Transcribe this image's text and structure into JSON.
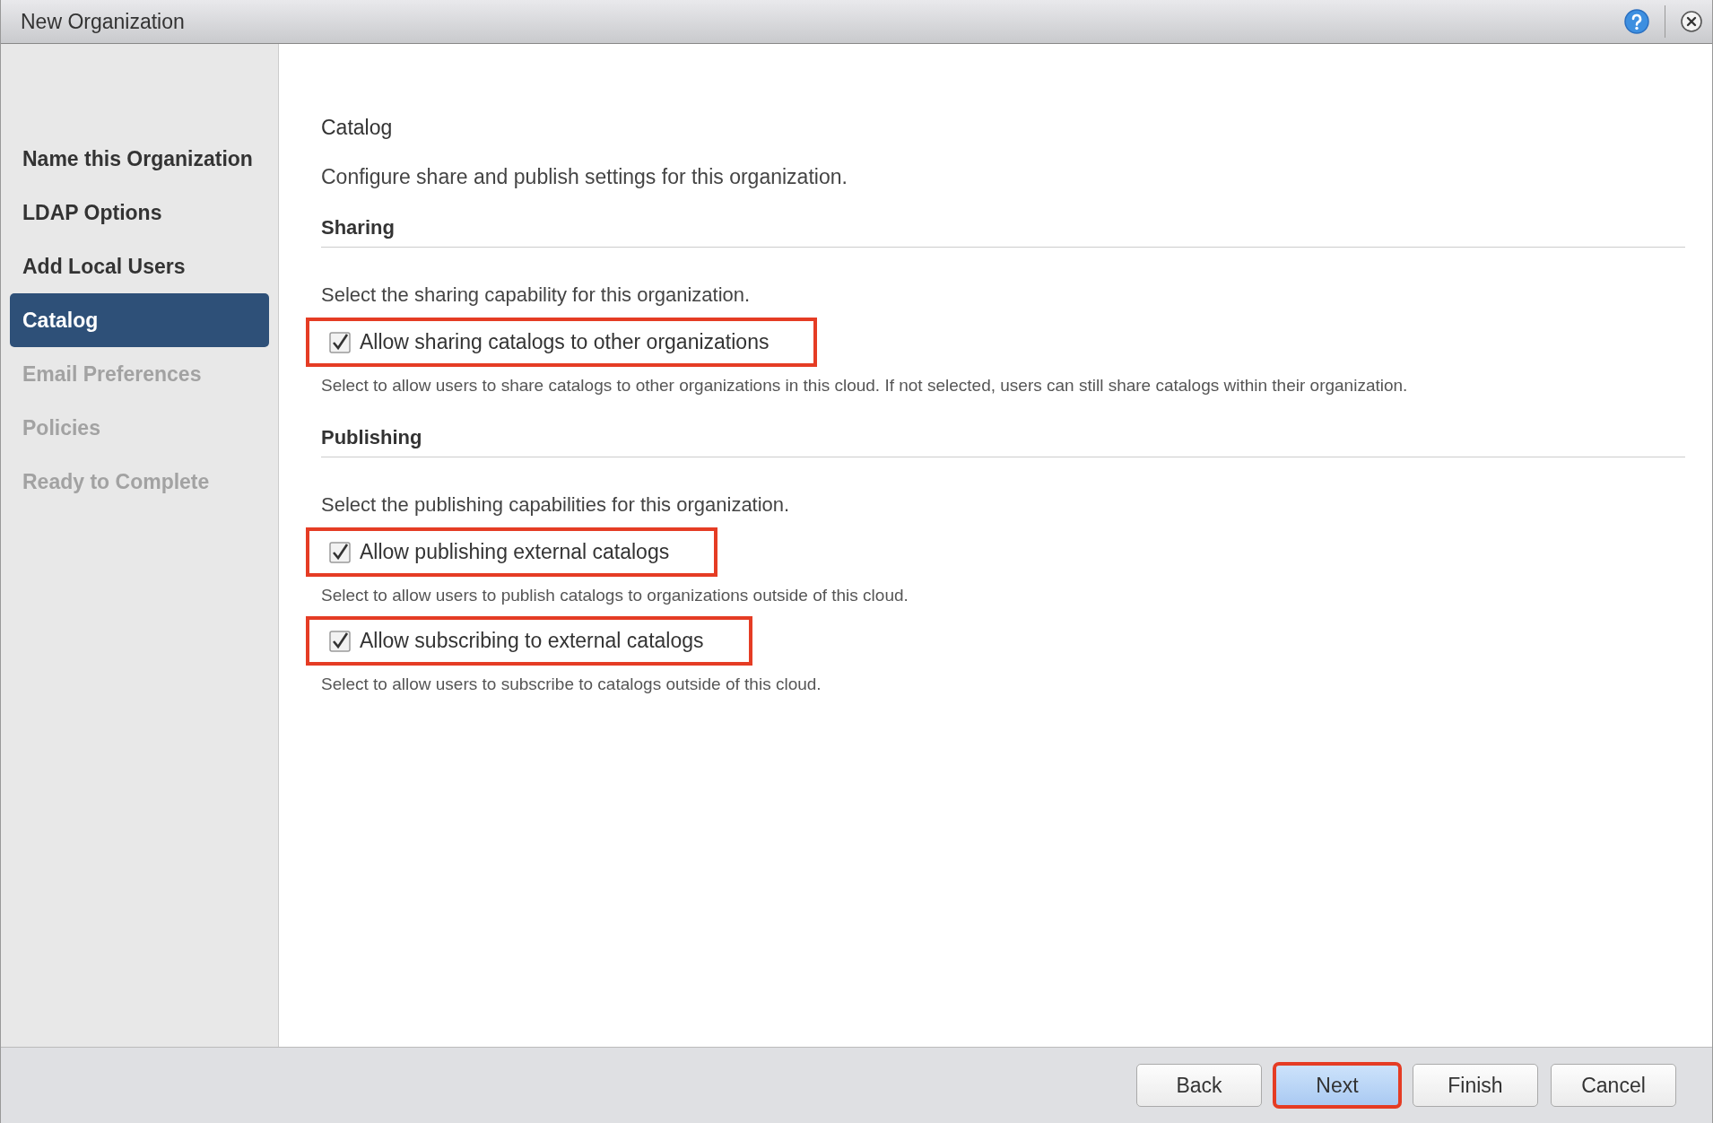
{
  "window": {
    "title": "New Organization"
  },
  "sidebar": {
    "items": [
      {
        "label": "Name this Organization",
        "selected": false,
        "disabled": false
      },
      {
        "label": "LDAP Options",
        "selected": false,
        "disabled": false
      },
      {
        "label": "Add Local Users",
        "selected": false,
        "disabled": false
      },
      {
        "label": "Catalog",
        "selected": true,
        "disabled": false
      },
      {
        "label": "Email Preferences",
        "selected": false,
        "disabled": true
      },
      {
        "label": "Policies",
        "selected": false,
        "disabled": true
      },
      {
        "label": "Ready to Complete",
        "selected": false,
        "disabled": true
      }
    ]
  },
  "page": {
    "title": "Catalog",
    "description": "Configure share and publish settings for this organization.",
    "sections": [
      {
        "heading": "Sharing",
        "prompt": "Select the sharing capability for this organization.",
        "options": [
          {
            "label": "Allow sharing catalogs to other organizations",
            "checked": true,
            "highlighted": true,
            "hint": "Select to allow users to share catalogs to other organizations in this cloud. If not selected, users can still share catalogs within their organization."
          }
        ]
      },
      {
        "heading": "Publishing",
        "prompt": "Select the publishing capabilities for this organization.",
        "options": [
          {
            "label": "Allow publishing external catalogs",
            "checked": true,
            "highlighted": true,
            "hint": "Select to allow users to publish catalogs to organizations outside of this cloud."
          },
          {
            "label": "Allow subscribing to external catalogs",
            "checked": true,
            "highlighted": true,
            "hint": "Select to allow users to subscribe to catalogs outside of this cloud."
          }
        ]
      }
    ]
  },
  "buttons": [
    {
      "label": "Back",
      "selected": false,
      "highlighted": false
    },
    {
      "label": "Next",
      "selected": true,
      "highlighted": true
    },
    {
      "label": "Finish",
      "selected": false,
      "highlighted": false
    },
    {
      "label": "Cancel",
      "selected": false,
      "highlighted": false
    }
  ]
}
